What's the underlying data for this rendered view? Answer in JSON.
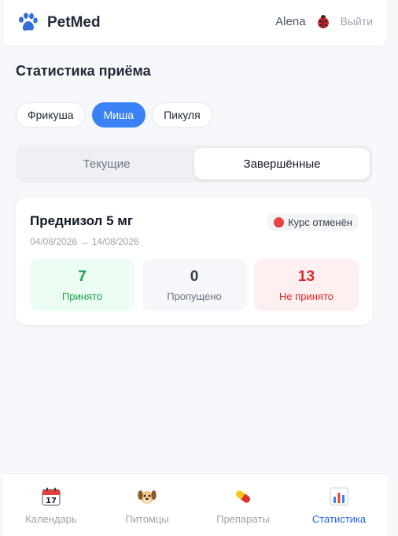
{
  "header": {
    "app_title": "PetMed",
    "logo_icon": "paw-icon",
    "username": "Alena",
    "avatar_icon": "ladybug-icon",
    "logout_label": "Выйти"
  },
  "page": {
    "title": "Статистика приёма"
  },
  "pets": [
    {
      "name": "Фрикуша",
      "active": false
    },
    {
      "name": "Миша",
      "active": true
    },
    {
      "name": "Пикуля",
      "active": false
    }
  ],
  "tabs": [
    {
      "label": "Текущие",
      "active": false
    },
    {
      "label": "Завершённые",
      "active": true
    }
  ],
  "course": {
    "drug": "Преднизол 5 мг",
    "status_icon": "stop-icon",
    "status": "Курс отменён",
    "dates": "04/08/2026 → 14/08/2026",
    "stats": [
      {
        "value": "7",
        "label": "Принято"
      },
      {
        "value": "0",
        "label": "Пропущено"
      },
      {
        "value": "13",
        "label": "Не принято"
      }
    ]
  },
  "nav": [
    {
      "label": "Календарь",
      "icon": "calendar-icon",
      "active": false
    },
    {
      "label": "Питомцы",
      "icon": "dog-icon",
      "active": false
    },
    {
      "label": "Препараты",
      "icon": "pill-icon",
      "active": false
    },
    {
      "label": "Статистика",
      "icon": "bar-chart-icon",
      "active": true
    }
  ],
  "colors": {
    "accent": "#3b82f6",
    "taken": "#16a34a",
    "not_taken": "#dc2626",
    "nav_active": "#2563eb"
  }
}
